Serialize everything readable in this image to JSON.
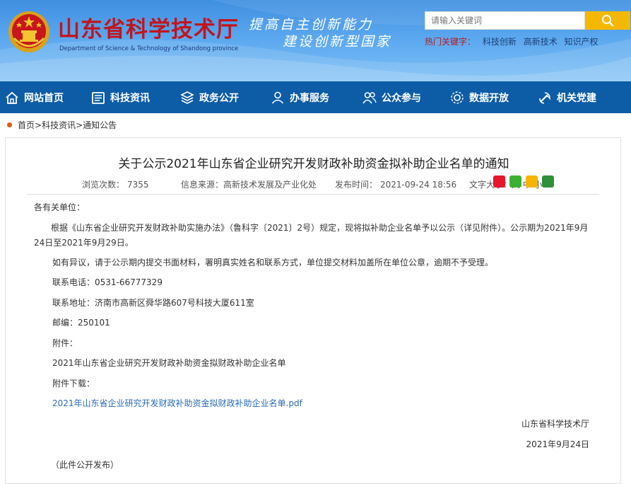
{
  "header": {
    "site_title": "山东省科学技术厅",
    "site_subtitle": "Department of Science & Technology of Shandong province",
    "slogan_line1": "提高自主创新能力",
    "slogan_line2": "建设创新型国家",
    "search_placeholder": "请输入关键词",
    "hot_label": "热门关键字：",
    "hot_keywords": [
      "科技创新",
      "高新技术",
      "知识产权"
    ]
  },
  "nav": {
    "items": [
      {
        "label": "网站首页",
        "icon": "home-icon"
      },
      {
        "label": "科技资讯",
        "icon": "news-icon"
      },
      {
        "label": "政务公开",
        "icon": "layers-icon"
      },
      {
        "label": "办事服务",
        "icon": "user-icon"
      },
      {
        "label": "公众参与",
        "icon": "people-icon"
      },
      {
        "label": "数据开放",
        "icon": "data-icon"
      },
      {
        "label": "机关党建",
        "icon": "party-icon"
      }
    ]
  },
  "breadcrumb": {
    "home": "首页",
    "sep1": ">",
    "section": "科技资讯",
    "sep2": ">",
    "current": "通知公告"
  },
  "article": {
    "title": "关于公示2021年山东省企业研究开发财政补助资金拟补助企业名单的通知",
    "views_label": "浏览次数：",
    "views": "7355",
    "source_label": "信息来源：",
    "source": "高新技术发展及产业化处",
    "time_label": "发布时间：",
    "time": "2021-09-24 18:56",
    "font_label": "文字大小：",
    "font_options": "大 中 小",
    "salutation": "各有关单位：",
    "para1": "根据《山东省企业研究开发财政补助实施办法》（鲁科字〔2021〕2号）规定，现将拟补助企业名单予以公示（详见附件）。公示期为2021年9月24日至2021年9月29日。",
    "para2": "如有异议，请于公示期内提交书面材料，署明真实姓名和联系方式，单位提交材料加盖所在单位公章，逾期不予受理。",
    "phone": "联系电话：0531-66777329",
    "address": "联系地址：济南市高新区舜华路607号科技大厦611室",
    "postcode": "邮编：250101",
    "attach_label": "附件：",
    "attach_name": "2021年山东省企业研究开发财政补助资金拟财政补助企业名单",
    "download_label": "附件下载：",
    "download_link": "2021年山东省企业研究开发财政补助资金拟财政补助企业名单.pdf",
    "signature": "山东省科学技术厅",
    "date": "2021年9月24日",
    "note": "（此件公开发布）"
  },
  "colors": {
    "nav_bg": "#0d5ca6",
    "title_red": "#c2151b",
    "search_btn": "#f5b800",
    "link_blue": "#2a6bb7"
  }
}
